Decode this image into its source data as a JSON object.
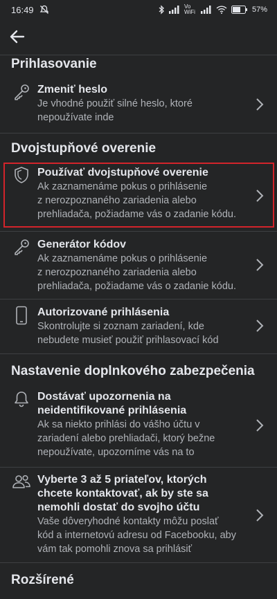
{
  "status_bar": {
    "time": "16:49",
    "battery": "57%",
    "network": "Vo WiFi"
  },
  "sections": {
    "login": "Prihlasovanie",
    "two_factor": "Dvojstupňové overenie",
    "extra_security": "Nastavenie doplnkového zabezpečenia",
    "advanced": "Rozšírené"
  },
  "rows": {
    "change_password": {
      "title": "Zmeniť heslo",
      "desc": "Je vhodné použiť silné heslo, ktoré\nnepoužívate inde"
    },
    "use_2fa": {
      "title": "Používať dvojstupňové overenie",
      "desc": "Ak zaznamenáme pokus o prihlásenie\nz nerozpoznaného zariadenia alebo\nprehliadača, požiadame vás o zadanie kódu."
    },
    "code_generator": {
      "title": "Generátor kódov",
      "desc": "Ak zaznamenáme pokus o prihlásenie\nz nerozpoznaného zariadenia alebo\nprehliadača, požiadame vás o zadanie kódu."
    },
    "authorized_logins": {
      "title": "Autorizované prihlásenia",
      "desc": "Skontrolujte si zoznam zariadení, kde\nnebudete musieť použiť prihlasovací kód"
    },
    "alerts": {
      "title": "Dostávať upozornenia na\nneidentifikované prihlásenia",
      "desc": "Ak sa niekto prihlási do vášho účtu v\nzariadení alebo prehliadači, ktorý bežne\nnepoužívate, upozorníme vás na to"
    },
    "trusted_friends": {
      "title": "Vyberte 3 až 5 priateľov, ktorých\nchcete kontaktovať, ak by ste sa\nnemohli dostať do svojho účtu",
      "desc": "Vaše dôveryhodné kontakty môžu poslať\nkód a internetovú adresu od Facebooku, aby\nvám tak pomohli znova sa prihlásiť"
    }
  },
  "colors": {
    "background": "#242526",
    "highlight": "#d3242b",
    "secondary_text": "#b0b3b8"
  }
}
